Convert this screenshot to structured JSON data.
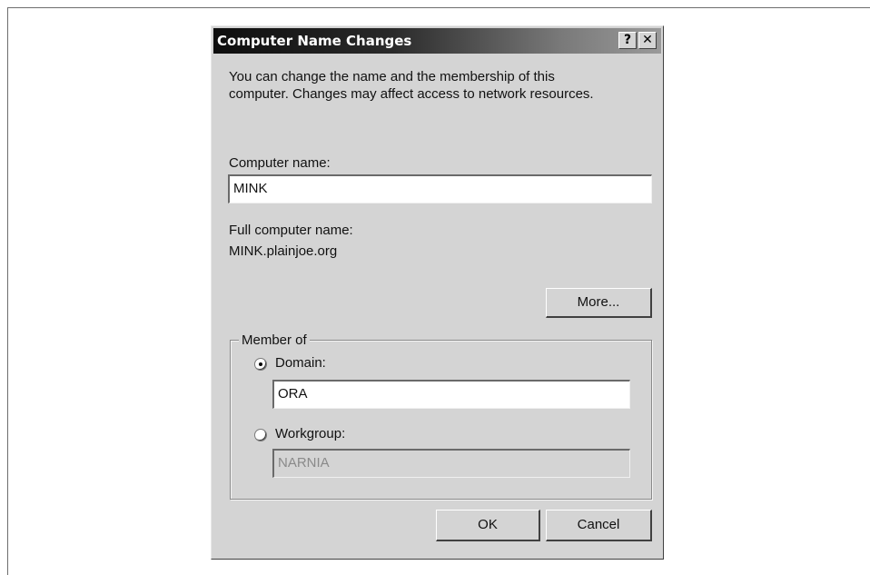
{
  "dialog": {
    "title": "Computer Name Changes",
    "help_label": "?",
    "close_label": "✕",
    "description_line1": "You can change the name and the membership of this",
    "description_line2": "computer. Changes may affect access to network resources.",
    "computer_name_label": "Computer name:",
    "computer_name_value": "MINK",
    "full_name_label": "Full computer name:",
    "full_name_value": "MINK.plainjoe.org",
    "more_button": "More...",
    "member_of": {
      "legend": "Member of",
      "domain_label": "Domain:",
      "domain_value": "ORA",
      "domain_selected": true,
      "workgroup_label": "Workgroup:",
      "workgroup_value": "NARNIA",
      "workgroup_selected": false
    },
    "ok_button": "OK",
    "cancel_button": "Cancel"
  }
}
